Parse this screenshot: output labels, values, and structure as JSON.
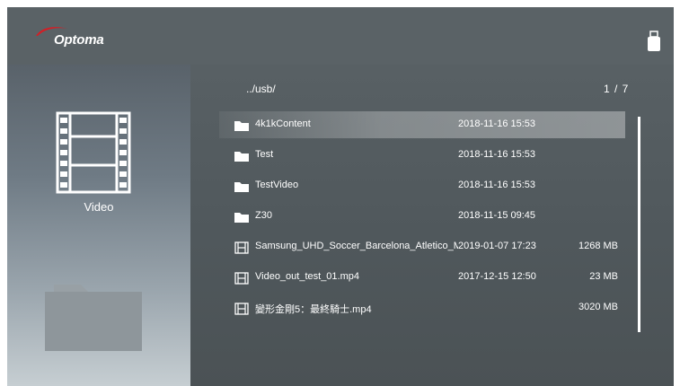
{
  "brand": {
    "logo_text": "Optoma",
    "accent": "#d21f26"
  },
  "device_icon": "usb-drive-icon",
  "category": {
    "label": "Video",
    "icon": "film-strip-icon"
  },
  "browser": {
    "path": "../usb/",
    "page": "1 / 7",
    "files": [
      {
        "type": "folder",
        "name": "4k1kContent",
        "date": "2018-11-16 15:53",
        "size": "",
        "selected": true
      },
      {
        "type": "folder",
        "name": "Test",
        "date": "2018-11-16 15:53",
        "size": ""
      },
      {
        "type": "folder",
        "name": "TestVideo",
        "date": "2018-11-16 15:53",
        "size": ""
      },
      {
        "type": "folder",
        "name": "Z30",
        "date": "2018-11-15 09:45",
        "size": ""
      },
      {
        "type": "video",
        "name": "Samsung_UHD_Soccer_Barcelona_Atletico_Madrid",
        "date": "2019-01-07 17:23",
        "size": "1268 MB"
      },
      {
        "type": "video",
        "name": "Video_out_test_01.mp4",
        "date": "2017-12-15 12:50",
        "size": "23 MB"
      },
      {
        "type": "video",
        "name": "變形金剛5：最終騎士.mp4",
        "date": "",
        "size": "3020 MB"
      }
    ]
  }
}
